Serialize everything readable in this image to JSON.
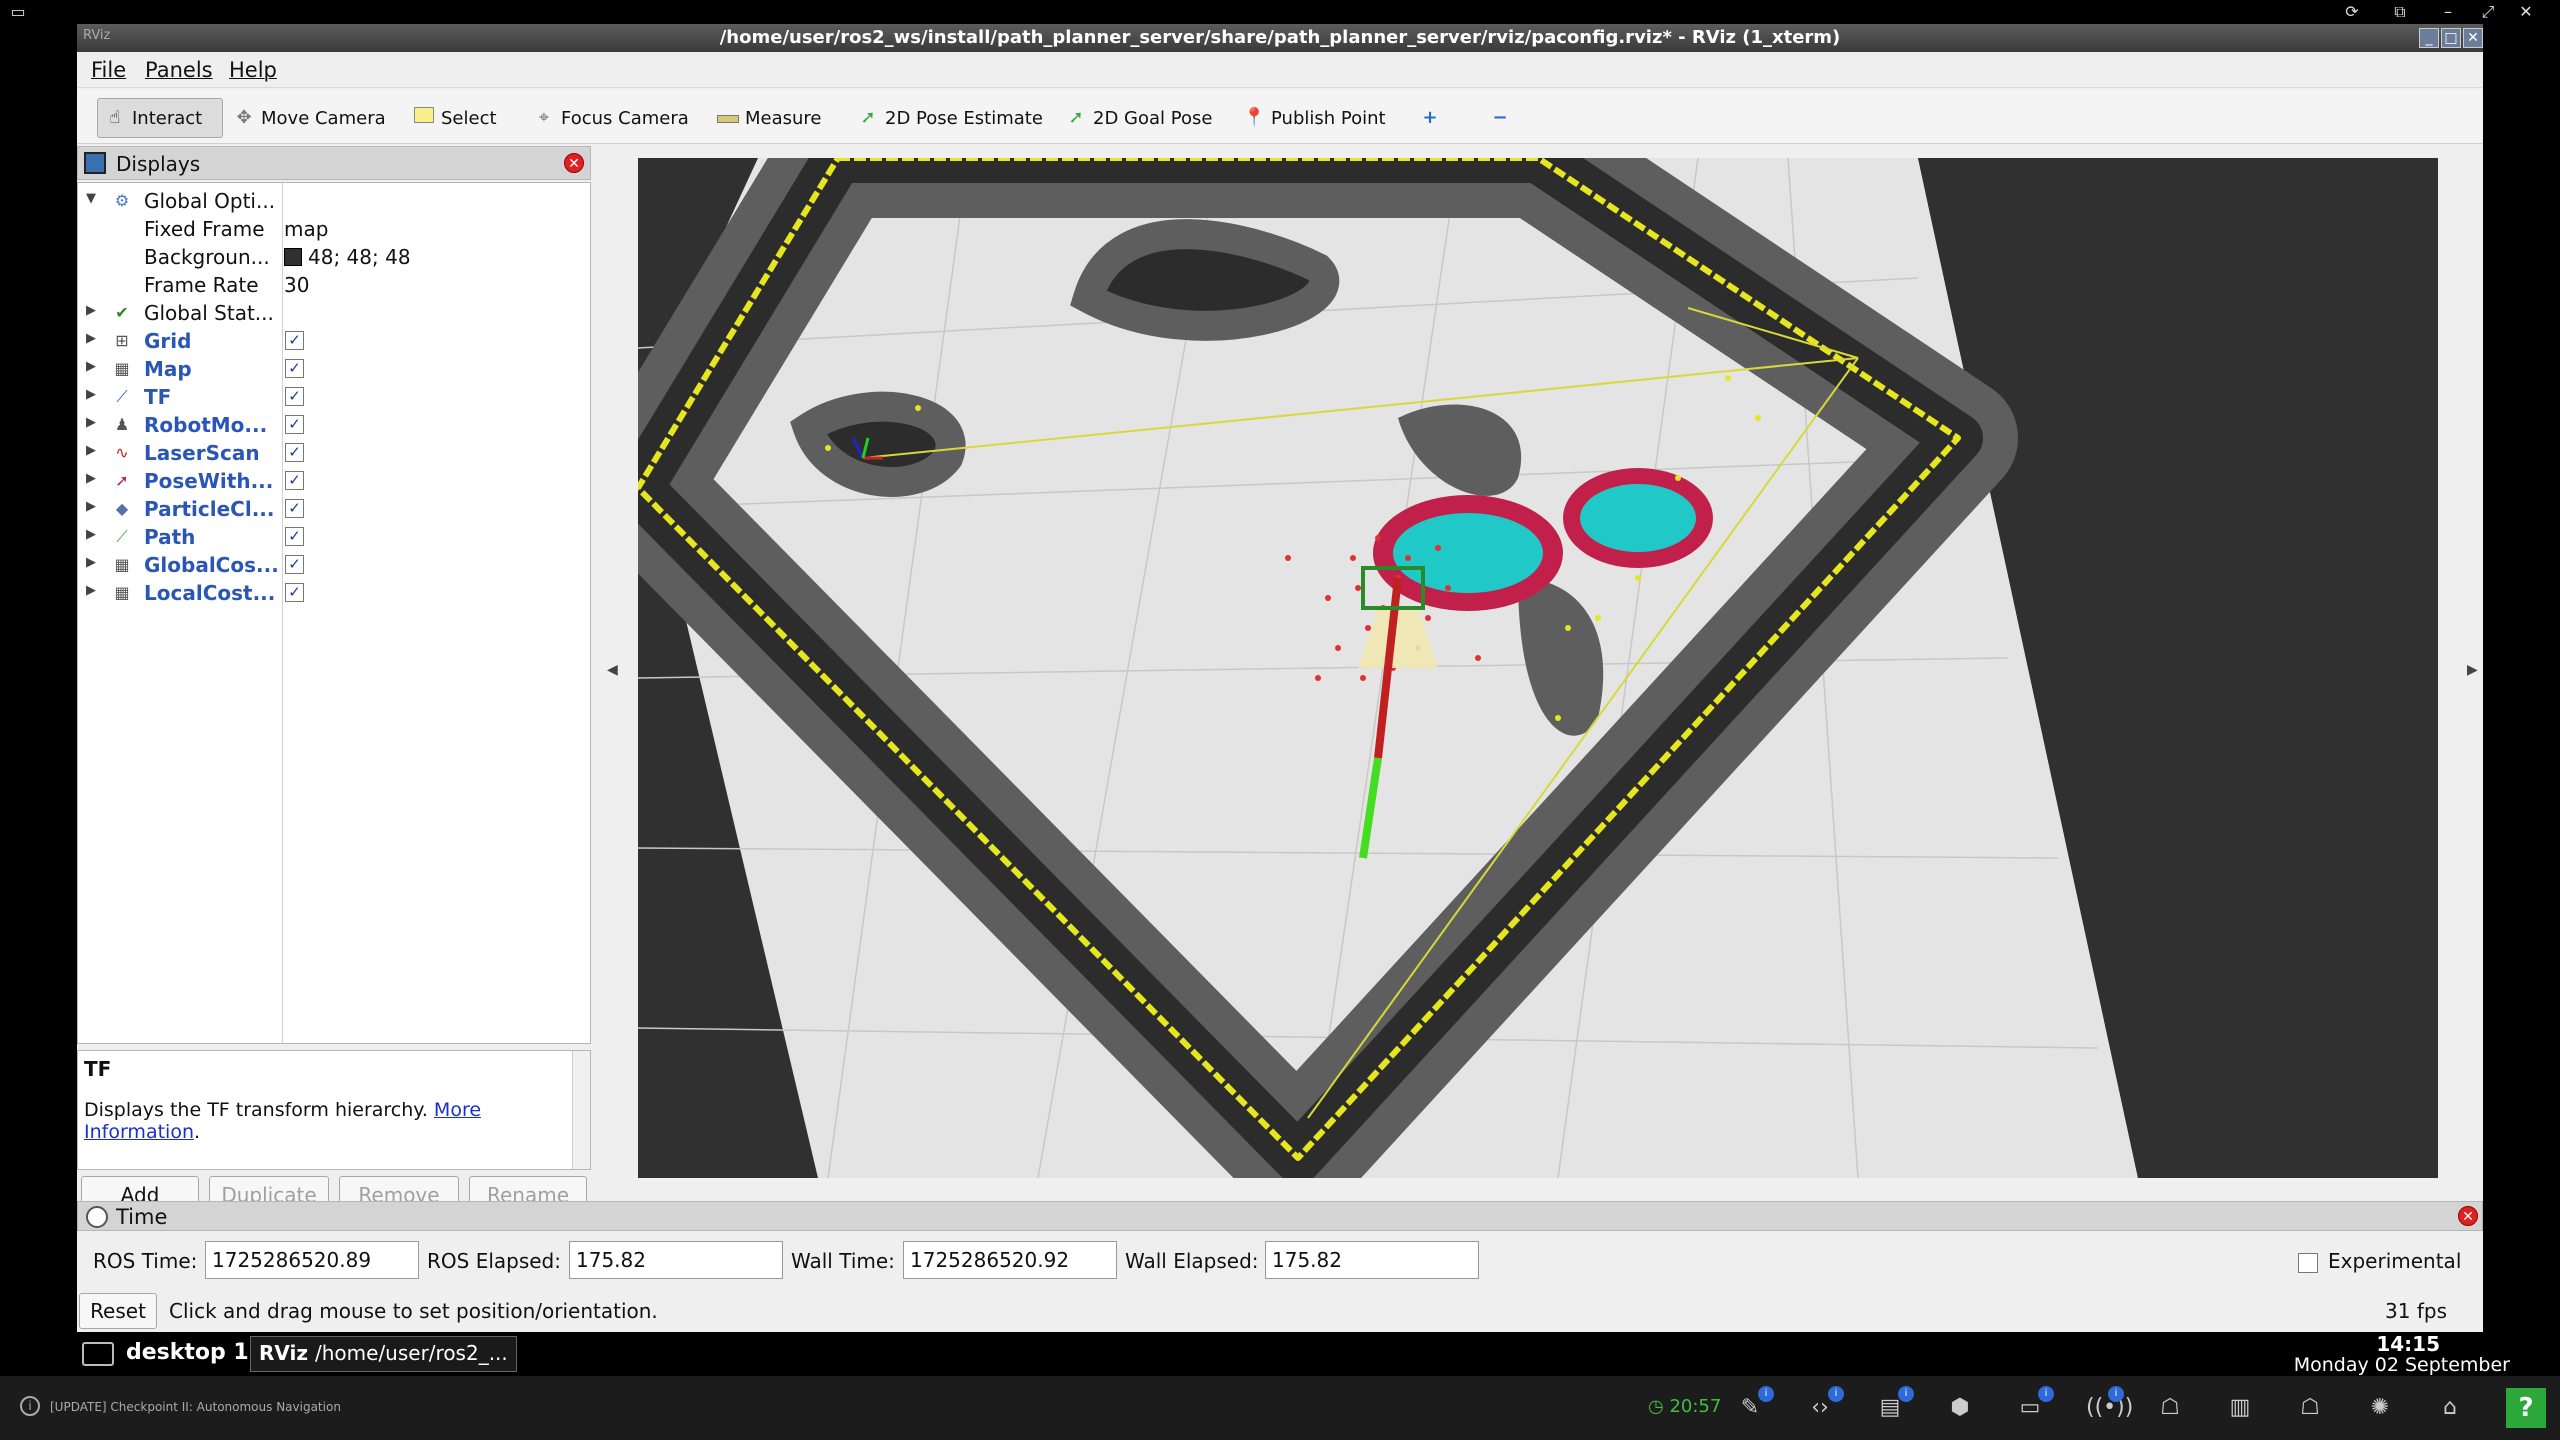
{
  "window": {
    "title": "/home/user/ros2_ws/install/path_planner_server/share/path_planner_server/rviz/paconfig.rviz* - RViz (1_xterm)"
  },
  "menu": {
    "file": "File",
    "panels": "Panels",
    "help": "Help"
  },
  "toolbar": {
    "interact": "Interact",
    "move_camera": "Move Camera",
    "select": "Select",
    "focus_camera": "Focus Camera",
    "measure": "Measure",
    "pose_estimate": "2D Pose Estimate",
    "goal_pose": "2D Goal Pose",
    "publish_point": "Publish Point"
  },
  "displays": {
    "title": "Displays",
    "global_options": {
      "label": "Global Opti...",
      "fixed_frame_label": "Fixed Frame",
      "fixed_frame_value": "map",
      "background_label": "Backgroun...",
      "background_value": "48; 48; 48",
      "background_color": "#303030",
      "frame_rate_label": "Frame Rate",
      "frame_rate_value": "30"
    },
    "global_status": "Global Stat...",
    "items": [
      {
        "label": "Grid",
        "icon": "grid-icon",
        "checked": true
      },
      {
        "label": "Map",
        "icon": "map-icon",
        "checked": true
      },
      {
        "label": "TF",
        "icon": "tf-icon",
        "checked": true
      },
      {
        "label": "RobotMo...",
        "icon": "robot-model-icon",
        "checked": true
      },
      {
        "label": "LaserScan",
        "icon": "laser-scan-icon",
        "checked": true
      },
      {
        "label": "PoseWith...",
        "icon": "pose-icon",
        "checked": true
      },
      {
        "label": "ParticleCl...",
        "icon": "particle-cloud-icon",
        "checked": true
      },
      {
        "label": "Path",
        "icon": "path-icon",
        "checked": true
      },
      {
        "label": "GlobalCos...",
        "icon": "costmap-icon",
        "checked": true
      },
      {
        "label": "LocalCost...",
        "icon": "costmap-icon",
        "checked": true
      }
    ],
    "description": {
      "title": "TF",
      "text": "Displays the TF transform hierarchy.",
      "link1": "More",
      "link2": "Information"
    },
    "buttons": {
      "add": "Add",
      "duplicate": "Duplicate",
      "remove": "Remove",
      "rename": "Rename"
    }
  },
  "time": {
    "title": "Time",
    "ros_time_label": "ROS Time:",
    "ros_time": "1725286520.89",
    "ros_elapsed_label": "ROS Elapsed:",
    "ros_elapsed": "175.82",
    "wall_time_label": "Wall Time:",
    "wall_time": "1725286520.92",
    "wall_elapsed_label": "Wall Elapsed:",
    "wall_elapsed": "175.82",
    "experimental": "Experimental",
    "reset": "Reset",
    "status": "Click and drag mouse to set position/orientation.",
    "fps": "31 fps"
  },
  "desktop": {
    "label": "desktop 1",
    "task": "/home/user/ros2_...",
    "clock": "14:15",
    "date": "Monday 02 September"
  },
  "system": {
    "notice": "[UPDATE] Checkpoint II: Autonomous Navigation",
    "timer": "20:57",
    "help": "?"
  },
  "colors": {
    "costmap_dark": "#303030",
    "costmap_inflation": "#6a6a6a",
    "free_space": "#ececec",
    "laser": "#e8e820",
    "path": "#44dd22",
    "particles": "#e03030",
    "local_cost_cyan": "#20c8c8",
    "local_cost_red": "#c0204a"
  }
}
